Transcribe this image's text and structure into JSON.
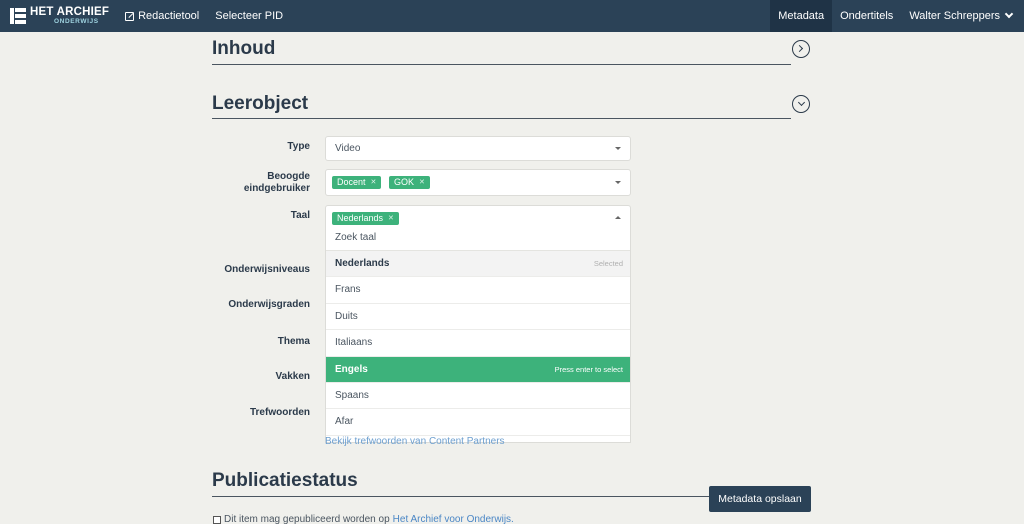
{
  "nav": {
    "logo_title": "HET ARCHIEF",
    "logo_subtitle": "ONDERWIJS",
    "edit_tool": "Redactietool",
    "select_pid": "Selecteer PID",
    "metadata": "Metadata",
    "subtitles": "Ondertitels",
    "user": "Walter Schreppers"
  },
  "sections": {
    "inhoud": "Inhoud",
    "leerobject": "Leerobject",
    "publicatiestatus": "Publicatiestatus"
  },
  "form": {
    "type": {
      "label": "Type",
      "value": "Video"
    },
    "eindgebruiker": {
      "label_line1": "Beoogde",
      "label_line2": "eindgebruiker",
      "tags": [
        "Docent",
        "GOK"
      ]
    },
    "taal": {
      "label": "Taal",
      "tags": [
        "Nederlands"
      ],
      "search_placeholder": "Zoek taal"
    },
    "onderwijsniveaus": {
      "label": "Onderwijsniveaus"
    },
    "onderwijsgraden": {
      "label": "Onderwijsgraden"
    },
    "thema": {
      "label": "Thema"
    },
    "vakken": {
      "label": "Vakken"
    },
    "trefwoorden": {
      "label": "Trefwoorden",
      "link": "Bekijk trefwoorden van Content Partners"
    }
  },
  "dropdown": {
    "options": [
      {
        "label": "Nederlands",
        "hint": "Selected",
        "state": "selected"
      },
      {
        "label": "Frans",
        "hint": "",
        "state": ""
      },
      {
        "label": "Duits",
        "hint": "",
        "state": ""
      },
      {
        "label": "Italiaans",
        "hint": "",
        "state": ""
      },
      {
        "label": "Engels",
        "hint": "Press enter to select",
        "state": "highlighted"
      },
      {
        "label": "Spaans",
        "hint": "",
        "state": ""
      },
      {
        "label": "Afar",
        "hint": "",
        "state": ""
      }
    ]
  },
  "actions": {
    "save": "Metadata opslaan"
  },
  "publish": {
    "text": "Dit item mag gepubliceerd worden op",
    "link": "Het Archief voor Onderwijs."
  },
  "colors": {
    "navbar": "#2b4257",
    "accent": "#3db27b",
    "link": "#4a86c5"
  }
}
